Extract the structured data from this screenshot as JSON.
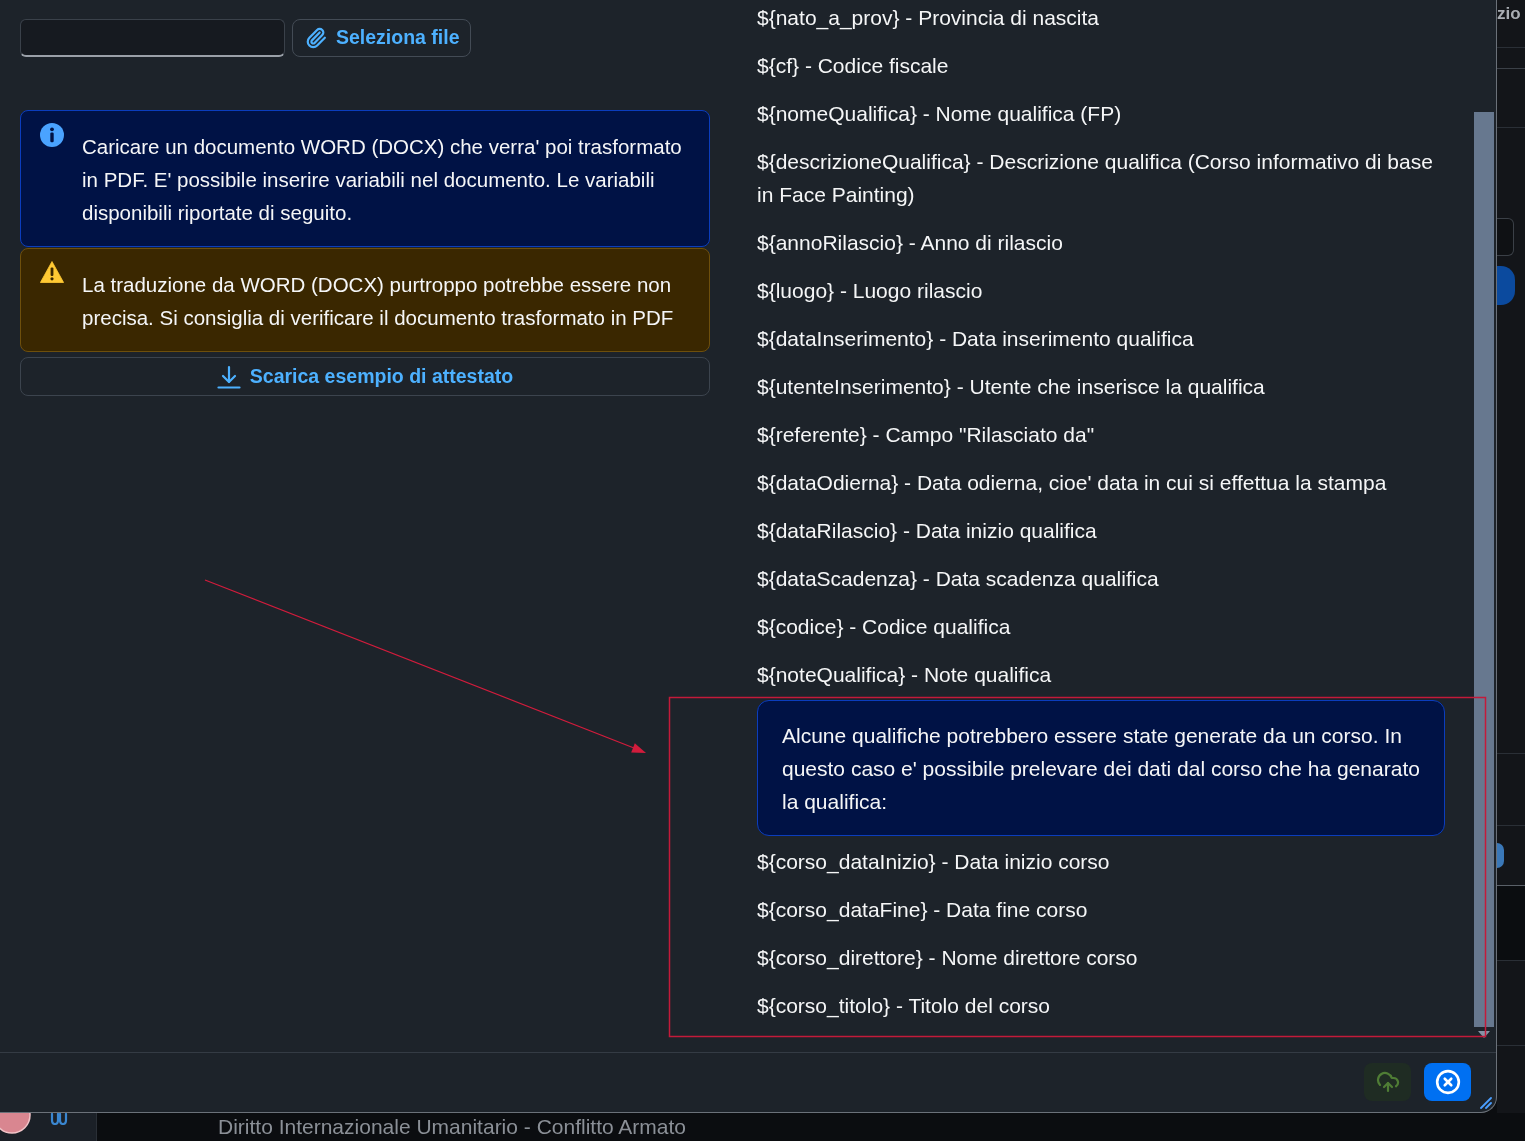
{
  "dialog": {
    "select_file_button": "Seleziona file",
    "notices": [
      {
        "kind": "info",
        "text": "Caricare un documento WORD (DOCX) che verra' poi trasformato in PDF. E' possibile inserire variabili nel documento. Le variabili disponibili riportate di seguito."
      },
      {
        "kind": "warning",
        "text": "La traduzione da WORD (DOCX) purtroppo potrebbe essere non precisa. Si consiglia di verificare il documento trasformato in PDF"
      }
    ],
    "download_button": "Scarica esempio di attestato",
    "variables": [
      "${nato_a_prov} - Provincia di nascita",
      "${cf} - Codice fiscale",
      "${nomeQualifica} - Nome qualifica (FP)",
      "${descrizioneQualifica} - Descrizione qualifica (Corso informativo di base in Face Painting)",
      "${annoRilascio} - Anno di rilascio",
      "${luogo} - Luogo rilascio",
      "${dataInserimento} - Data inserimento qualifica",
      "${utenteInserimento} - Utente che inserisce la qualifica",
      "${referente} - Campo \"Rilasciato da\"",
      "${dataOdierna} - Data odierna, cioe' data in cui si effettua la stampa",
      "${dataRilascio} - Data inizio qualifica",
      "${dataScadenza} - Data scadenza qualifica",
      "${codice} - Codice qualifica",
      "${noteQualifica} - Note qualifica"
    ],
    "course_note": "Alcune qualifiche potrebbero essere state generate da un corso. In questo caso e' possibile prelevare dei dati dal corso che ha genarato la qualifica:",
    "course_variables": [
      "${corso_dataInizio} - Data inizio corso",
      "${corso_dataFine} - Data fine corso",
      "${corso_direttore} - Nome direttore corso",
      "${corso_titolo} - Titolo del corso"
    ],
    "footer_buttons": [
      {
        "kind": "upload"
      },
      {
        "kind": "close"
      }
    ]
  },
  "background": {
    "heading_fragment": "zio",
    "list_item": "Diritto Internazionale Umanitario - Conflitto Armato"
  }
}
